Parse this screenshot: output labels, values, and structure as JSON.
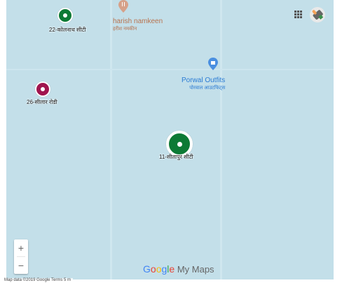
{
  "map": {
    "markers": [
      {
        "id": "m1",
        "label": "22-कोलनाथ सीटी",
        "color": "#0d7a35"
      },
      {
        "id": "m2",
        "label": "26-सीलार रोडी",
        "color": "#a0154e"
      },
      {
        "id": "m3",
        "label": "11-सीतापुर सीटी",
        "color": "#0d7a35",
        "selected": true
      }
    ],
    "places": [
      {
        "name": "harish namkeen",
        "subtitle": "हरीश नमकीन",
        "icon": "utensils-icon",
        "color": "#c3815a"
      },
      {
        "name": "Porwal Outfits",
        "subtitle": "पोरवाल आउटफिट्स",
        "icon": "shopping-bag-icon",
        "color": "#2a7bd4"
      }
    ]
  },
  "controls": {
    "zoom_in": "+",
    "zoom_out": "−",
    "apps_icon": "apps-grid-icon",
    "avatar_icon": "ink-finger-avatar-icon"
  },
  "branding": {
    "google": [
      "G",
      "o",
      "o",
      "g",
      "l",
      "e"
    ],
    "suffix": " My Maps"
  },
  "attribution": "Map data ©2019 Google   Terms   5 m"
}
